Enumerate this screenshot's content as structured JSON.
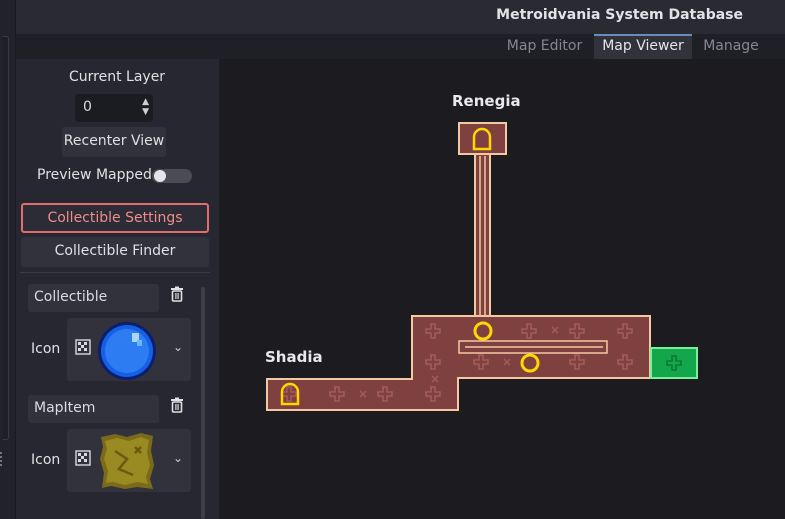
{
  "header": {
    "title": "Metroidvania System Database"
  },
  "tabs": [
    {
      "label": "Map Editor",
      "active": false
    },
    {
      "label": "Map Viewer",
      "active": true
    },
    {
      "label": "Manage",
      "active": false
    }
  ],
  "sidebar": {
    "current_layer_label": "Current Layer",
    "layer_value": "0",
    "recenter_label": "Recenter View",
    "preview_mapped_label": "Preview Mapped",
    "preview_mapped_on": false,
    "collectible_settings_label": "Collectible Settings",
    "collectible_finder_label": "Collectible Finder",
    "collectibles": [
      {
        "name": "Collectible",
        "icon_label": "Icon",
        "icon": "blue-orb-icon"
      },
      {
        "name": "MapItem",
        "icon_label": "Icon",
        "icon": "treasure-map-icon"
      }
    ]
  },
  "map": {
    "areas": [
      "Renegia",
      "Shadia"
    ],
    "colors": {
      "room": "#7f4040",
      "border": "#f4c9a0",
      "marker": "#ffd700",
      "special_room": "#13a64a"
    }
  }
}
